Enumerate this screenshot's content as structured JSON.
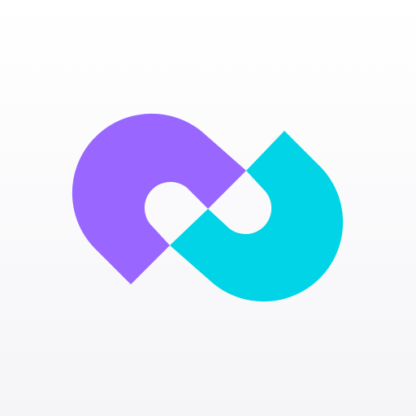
{
  "icon": {
    "name": "infinity-loop-logo",
    "colors": {
      "background_top": "#ffffff",
      "background_bottom": "#f5f5f8",
      "purple_loop": "#9966ff",
      "cyan_loop": "#00d4e6"
    }
  }
}
